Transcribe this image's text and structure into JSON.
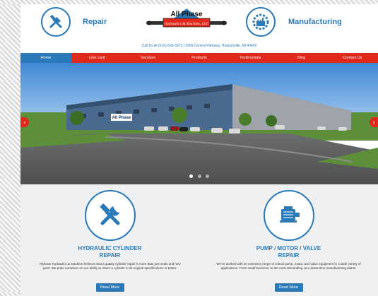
{
  "header": {
    "repair_label": "Repair",
    "manufacturing_label": "Manufacturing",
    "logo_text_main": "All Phase",
    "logo_text_sub": "Hydraulics & Machine, LLC",
    "contact": "Call Us At (616) 669-3973 |  3909 Central Parkway, Hudsonville, MI 49426"
  },
  "nav": {
    "items": [
      {
        "label": "Home",
        "active": true
      },
      {
        "label": "Line card"
      },
      {
        "label": "Services"
      },
      {
        "label": "Products"
      },
      {
        "label": "Testimonials"
      },
      {
        "label": "Blog"
      },
      {
        "label": "Contact Us"
      }
    ]
  },
  "hero": {
    "sign_text": "All Phase",
    "prev": "‹",
    "next": "›"
  },
  "services": [
    {
      "title_line1": "HYDRAULIC CYLINDER",
      "title_line2": "REPAIR",
      "text": "Allphase Hydraulics & Machine believes that a quality cylinder repair is more than just seals and new paint. We pride ourselves on our ability to return a cylinder to its original specifications or better.",
      "button": "Read More"
    },
    {
      "title_line1": "PUMP / MOTOR / VALVE",
      "title_line2": "REPAIR",
      "text": "We've worked with an extensive range of critical pump, motor, and valve equipment in a wide variety of applications.  From small business, to the most demanding zero down-time manufacturing plants.",
      "button": "Read More"
    }
  ],
  "colors": {
    "brand_blue": "#2a79b8",
    "nav_red": "#e0281b"
  }
}
